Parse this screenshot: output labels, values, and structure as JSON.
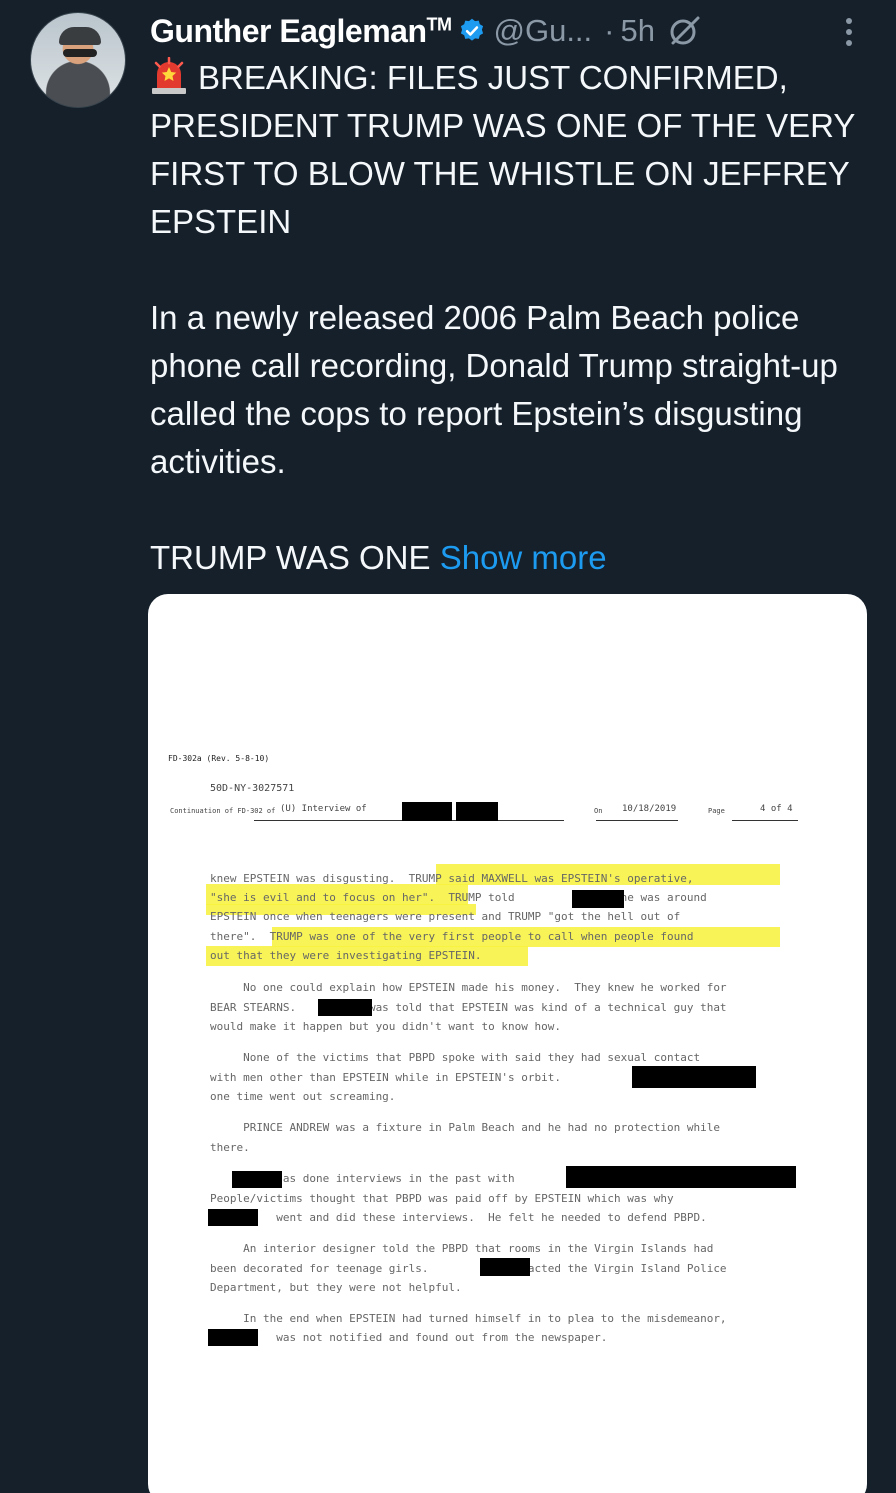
{
  "tweet": {
    "author_name": "Gunther Eagleman",
    "author_tm": "TM",
    "handle": "@Gu...",
    "separator": "·",
    "time": "5h",
    "paragraph1": "BREAKING: FILES JUST CONFIRMED, PRESIDENT TRUMP WAS ONE OF THE VERY FIRST TO BLOW THE WHISTLE ON JEFFREY EPSTEIN",
    "paragraph2": "In a newly released 2006 Palm Beach police phone call recording, Donald Trump straight-up called the cops to report Epstein’s disgusting activities.",
    "paragraph3": "TRUMP WAS ONE",
    "show_more": "Show more",
    "icons": {
      "verified": "verified-badge-icon",
      "grok": "grok-icon",
      "more": "more-options-icon",
      "siren": "siren-emoji-icon"
    },
    "colors": {
      "background": "#15202b",
      "link": "#1d9bf0",
      "verified": "#1d9bf0",
      "secondary_text": "#8b98a5"
    }
  },
  "document": {
    "form_id": "FD-302a (Rev. 5-8-10)",
    "file_number": "50D-NY-3027571",
    "continuation_label": "Continuation of FD-302 of",
    "interview_label": "(U) Interview of",
    "on_label": "On",
    "date": "10/18/2019",
    "page_label": "Page",
    "page_value": "4 of 4",
    "lines": [
      "knew EPSTEIN was disgusting.  TRUMP said MAXWELL was EPSTEIN's operative,",
      "\"she is evil and to focus on her\".  TRUMP told           that he was around",
      "EPSTEIN once when teenagers were present and TRUMP \"got the hell out of",
      "there\".  TRUMP was one of the very first people to call when people found",
      "out that they were investigating EPSTEIN.",
      "     No one could explain how EPSTEIN made his money.  They knew he worked for",
      "BEAR STEARNS.           was told that EPSTEIN was kind of a technical guy that",
      "would make it happen but you didn't want to know how.",
      "     None of the victims that PBPD spoke with said they had sexual contact",
      "with men other than EPSTEIN while in EPSTEIN's orbit.                   had",
      "one time went out screaming.",
      "     PRINCE ANDREW was a fixture in Palm Beach and he had no protection while",
      "there.",
      "          has done interviews in the past with",
      "People/victims thought that PBPD was paid off by EPSTEIN which was why",
      "          went and did these interviews.  He felt he needed to defend PBPD.",
      "     An interior designer told the PBPD that rooms in the Virgin Islands had",
      "been decorated for teenage girls.           contacted the Virgin Island Police",
      "Department, but they were not helpful.",
      "     In the end when EPSTEIN had turned himself in to plea to the misdemeanor,",
      "          was not notified and found out from the newspaper."
    ]
  }
}
